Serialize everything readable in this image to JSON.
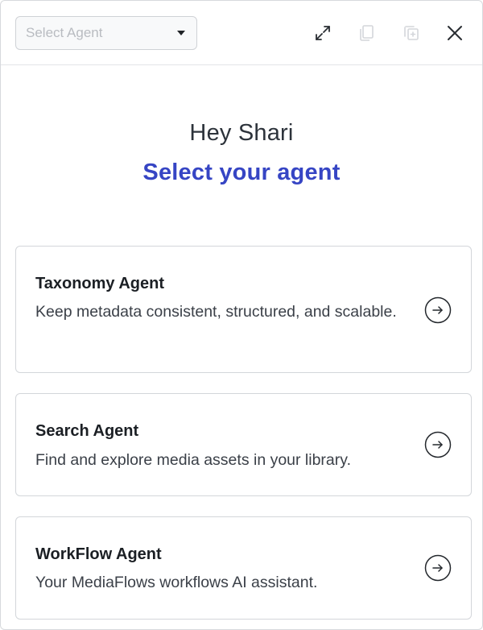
{
  "header": {
    "agent_select": {
      "placeholder": "Select Agent",
      "selected": ""
    },
    "icons": [
      "expand-icon",
      "copy-icon",
      "new-chat-icon",
      "close-icon"
    ]
  },
  "intro": {
    "greeting": "Hey Shari",
    "subtitle": "Select your agent"
  },
  "agents": [
    {
      "name": "Taxonomy Agent",
      "description": "Keep metadata consistent, structured, and scalable."
    },
    {
      "name": "Search Agent",
      "description": "Find and explore media assets in your library."
    },
    {
      "name": "WorkFlow Agent",
      "description": "Your MediaFlows workflows AI assistant."
    }
  ],
  "colors": {
    "accent": "#3645c4",
    "border": "#d3d6da",
    "muted_icon": "#d4d6da"
  }
}
